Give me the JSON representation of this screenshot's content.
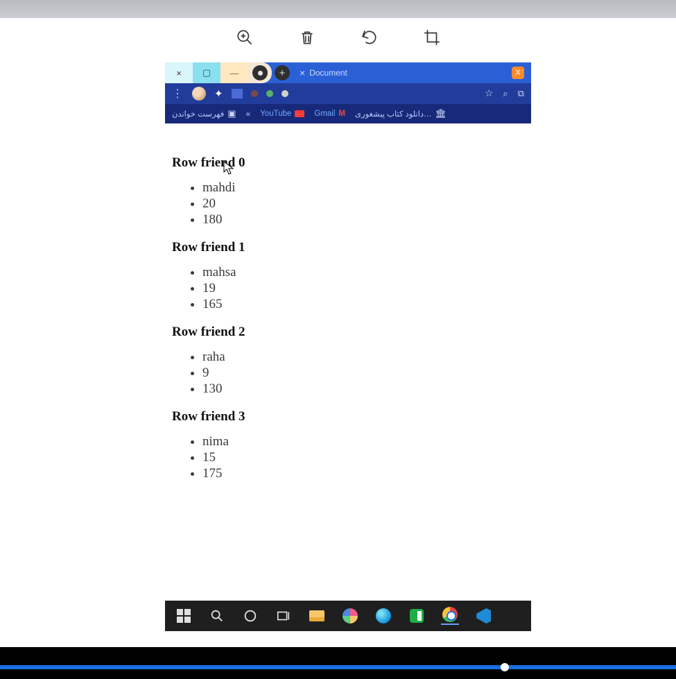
{
  "editor_toolbar": {
    "zoom_in": "zoom-in-icon",
    "trash": "trash-icon",
    "rotate": "rotate-icon",
    "crop": "crop-icon"
  },
  "browser": {
    "window_controls": {
      "close": "×",
      "maximize": "▢",
      "minimize": "—"
    },
    "tab": {
      "close": "×",
      "title": "Document",
      "ext_badge": "X"
    },
    "new_tab": "+",
    "bookmarks": {
      "reading_list": "فهرست خواندن",
      "youtube": "YouTube",
      "gmail": "Gmail",
      "book_download": "دانلود کتاب پیشغوری…"
    }
  },
  "page": {
    "rows": [
      {
        "heading": "Row friend 0",
        "items": [
          "mahdi",
          "20",
          "180"
        ]
      },
      {
        "heading": "Row friend 1",
        "items": [
          "mahsa",
          "19",
          "165"
        ]
      },
      {
        "heading": "Row friend 2",
        "items": [
          "raha",
          "9",
          "130"
        ]
      },
      {
        "heading": "Row friend 3",
        "items": [
          "nima",
          "15",
          "175"
        ]
      }
    ]
  },
  "video": {
    "progress_pct": 74
  }
}
